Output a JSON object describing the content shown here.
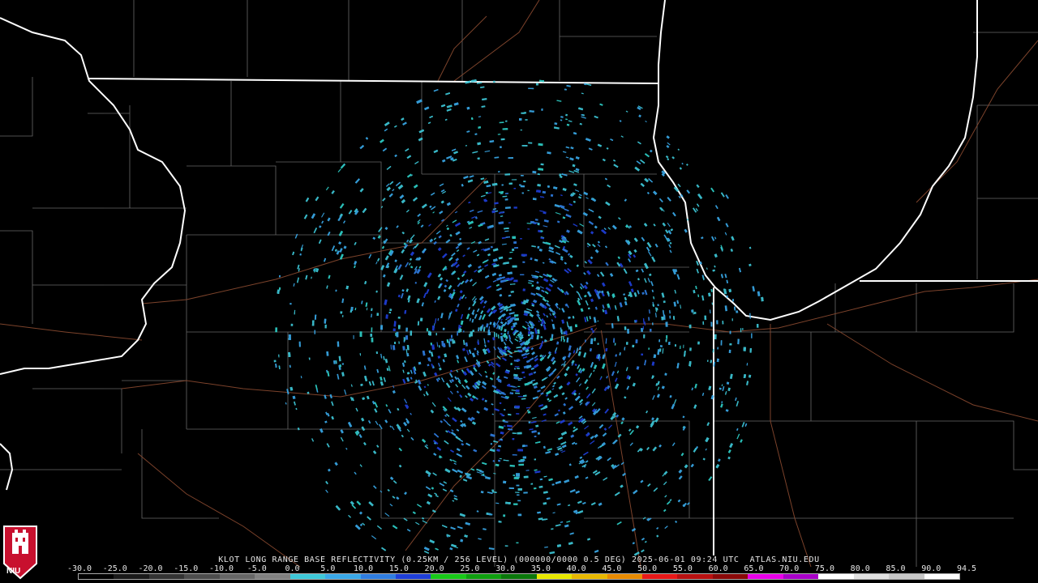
{
  "caption": "KLOT LONG RANGE BASE REFLECTIVITY (0.25KM / 256 LEVEL) (000000/0000 0.5 DEG) 2025-06-01 09:24 UTC  ATLAS.NIU.EDU",
  "scale": {
    "labels": [
      "-30.0",
      "-25.0",
      "-20.0",
      "-15.0",
      "-10.0",
      "-5.0",
      "0.0",
      "5.0",
      "10.0",
      "15.0",
      "20.0",
      "25.0",
      "30.0",
      "35.0",
      "40.0",
      "45.0",
      "50.0",
      "55.0",
      "60.0",
      "65.0",
      "70.0",
      "75.0",
      "80.0",
      "85.0",
      "90.0",
      "94.5"
    ],
    "colors": [
      "#000000",
      "#1a1a1a",
      "#333333",
      "#4d4d4d",
      "#666666",
      "#808080",
      "#3ec8d8",
      "#39a8e8",
      "#2f7de0",
      "#1f3fd8",
      "#18c818",
      "#0f9f0f",
      "#0a780a",
      "#e8e800",
      "#e8b800",
      "#e88a00",
      "#e81818",
      "#b81010",
      "#8a0808",
      "#e800e8",
      "#a800c8",
      "#ffffff",
      "#e0e0e0",
      "#c8c8c8",
      "#ffffff"
    ]
  },
  "radar": {
    "site": "KLOT",
    "colors": [
      "#3ec8d8",
      "#39a8e8",
      "#2f7de0",
      "#1f3fd8",
      "#2ed0c8"
    ]
  },
  "logo": {
    "text": "NIU",
    "color": "#c8102e"
  }
}
